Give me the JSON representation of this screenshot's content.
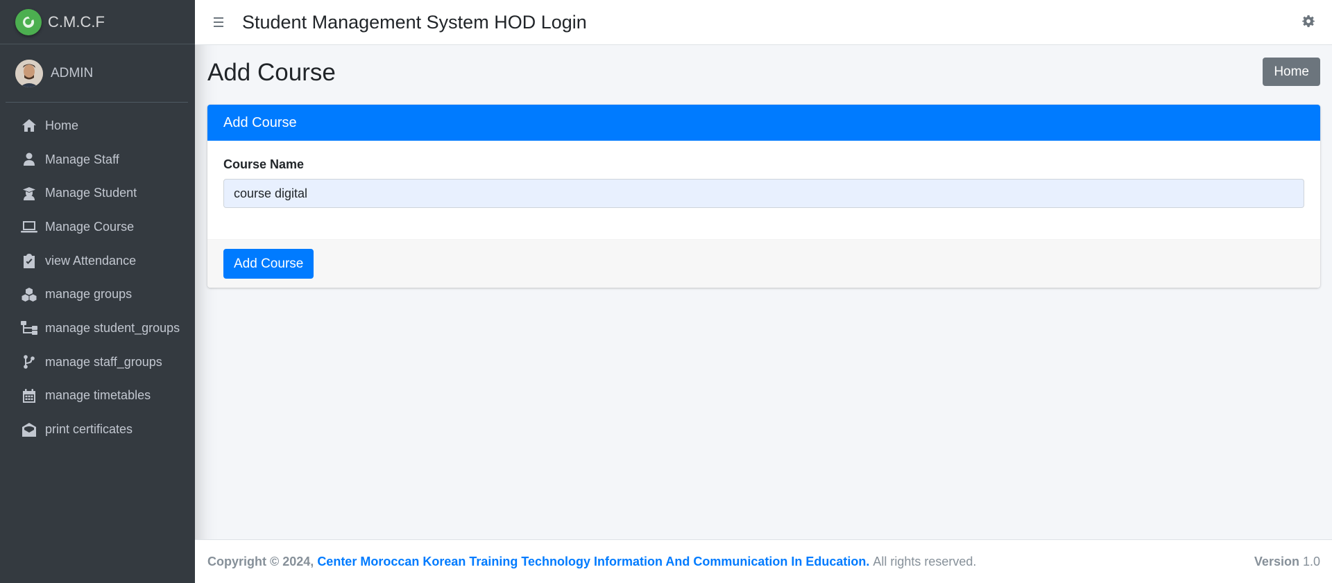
{
  "brand": {
    "name": "C.M.C.F",
    "logo_icon": "leaf-logo-icon",
    "logo_color": "#4caf50"
  },
  "user": {
    "name": "ADMIN"
  },
  "sidebar": {
    "items": [
      {
        "label": "Home",
        "icon": "home-icon"
      },
      {
        "label": "Manage Staff",
        "icon": "user-icon"
      },
      {
        "label": "Manage Student",
        "icon": "graduate-icon"
      },
      {
        "label": "Manage Course",
        "icon": "laptop-icon"
      },
      {
        "label": "view Attendance",
        "icon": "clipboard-check-icon"
      },
      {
        "label": "manage groups",
        "icon": "cubes-icon"
      },
      {
        "label": "manage student_groups",
        "icon": "sitemap-icon"
      },
      {
        "label": "manage staff_groups",
        "icon": "code-branch-icon"
      },
      {
        "label": "manage timetables",
        "icon": "calendar-icon"
      },
      {
        "label": "print certificates",
        "icon": "envelope-open-icon"
      }
    ]
  },
  "header": {
    "title": "Student Management System HOD Login"
  },
  "page": {
    "title": "Add Course",
    "home_button": "Home"
  },
  "form": {
    "card_title": "Add Course",
    "course_name_label": "Course Name",
    "course_name_value": "course digital",
    "submit_label": "Add Course"
  },
  "footer": {
    "copyright_prefix": "Copyright © 2024,",
    "organization": "Center Moroccan Korean Training Technology Information And Communication In Education.",
    "rights": "All rights reserved.",
    "version_label": "Version",
    "version_value": "1.0"
  },
  "colors": {
    "sidebar_bg": "#343a40",
    "primary": "#007bff",
    "secondary": "#6c757d",
    "content_bg": "#f4f6f9"
  }
}
